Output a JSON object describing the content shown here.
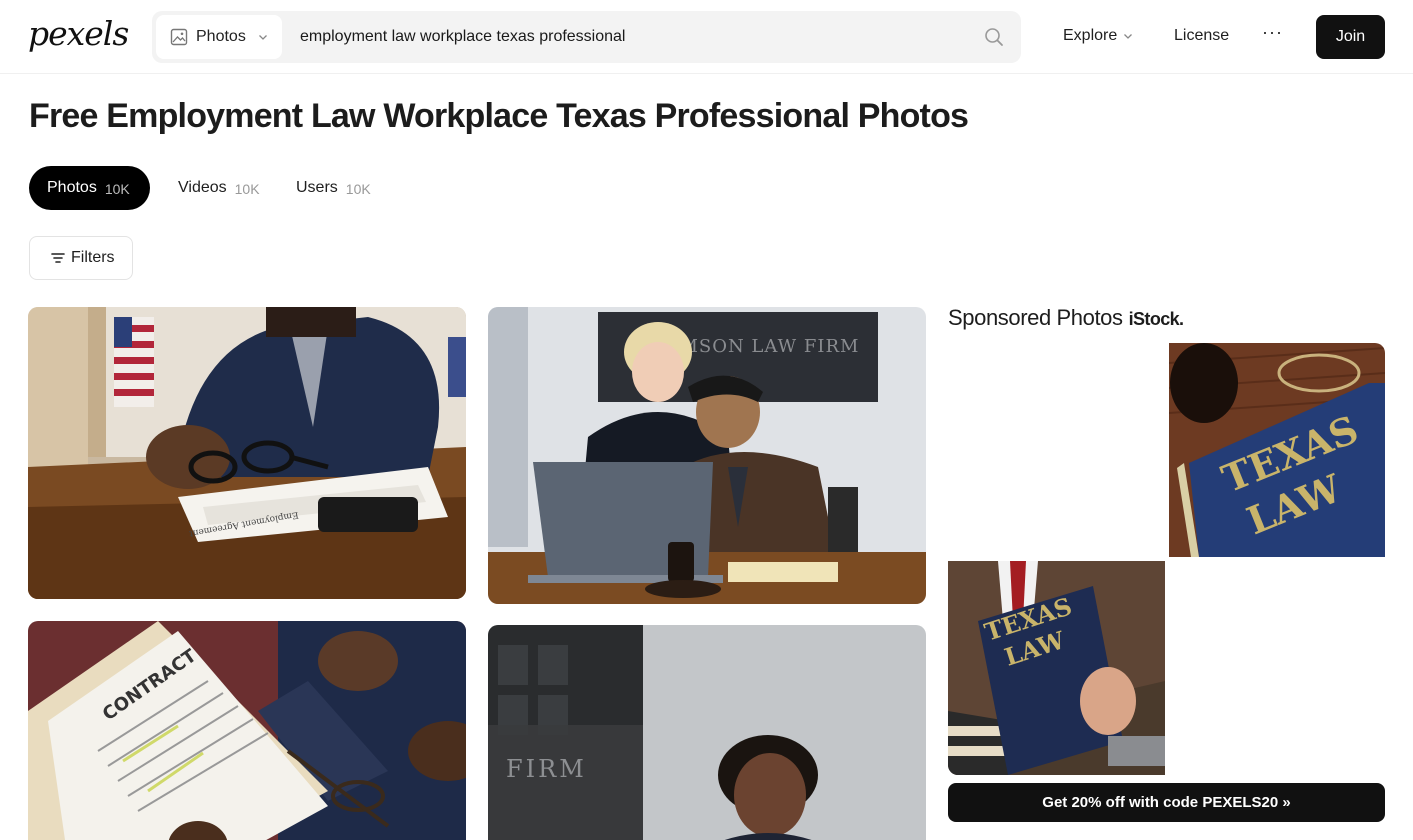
{
  "header": {
    "logo": "pexels",
    "search_type_label": "Photos",
    "search_query": "employment law workplace texas professional",
    "nav_explore": "Explore",
    "nav_license": "License",
    "nav_more": "···",
    "join_label": "Join"
  },
  "page": {
    "title": "Free Employment Law Workplace Texas Professional Photos"
  },
  "tabs": [
    {
      "label": "Photos",
      "count": "10K",
      "active": true
    },
    {
      "label": "Videos",
      "count": "10K",
      "active": false
    },
    {
      "label": "Users",
      "count": "10K",
      "active": false
    }
  ],
  "filters_label": "Filters",
  "photos": [
    {
      "description": "man at desk with glasses and employment agreement",
      "overlay_text": "Employment Agreement"
    },
    {
      "description": "lawyers looking at laptop",
      "overlay_text": "SIMSON LAW FIRM"
    },
    {
      "description": "hands holding contract and glasses",
      "overlay_text": "CONTRACT"
    },
    {
      "description": "woman in law firm office",
      "overlay_text": "FIRM"
    }
  ],
  "sponsored": {
    "title": "Sponsored Photos",
    "brand": "iStock.",
    "images": [
      {
        "text_line1": "TEXAS",
        "text_line2": "LAW"
      },
      {
        "text_line1": "TEXAS",
        "text_line2": "LAW"
      }
    ],
    "promo_label": "Get 20% off with code PEXELS20 »"
  },
  "colors": {
    "accent": "#000000",
    "search_bg": "#f3f3f3",
    "book_blue": "#233a72",
    "book_gold": "#c9b46a"
  }
}
